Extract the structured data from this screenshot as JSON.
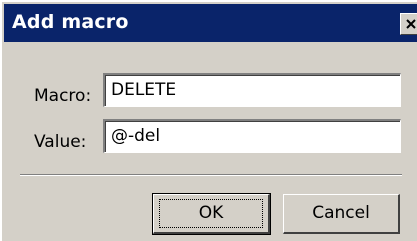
{
  "dialog": {
    "title": "Add macro",
    "close_icon": "close-icon",
    "fields": [
      {
        "label": "Macro:",
        "value": "DELETE"
      },
      {
        "label": "Value:",
        "value": "@-del"
      }
    ],
    "buttons": {
      "ok_label": "OK",
      "cancel_label": "Cancel"
    }
  },
  "colors": {
    "title_bar": "#0a246a",
    "face": "#d4d0c8"
  }
}
